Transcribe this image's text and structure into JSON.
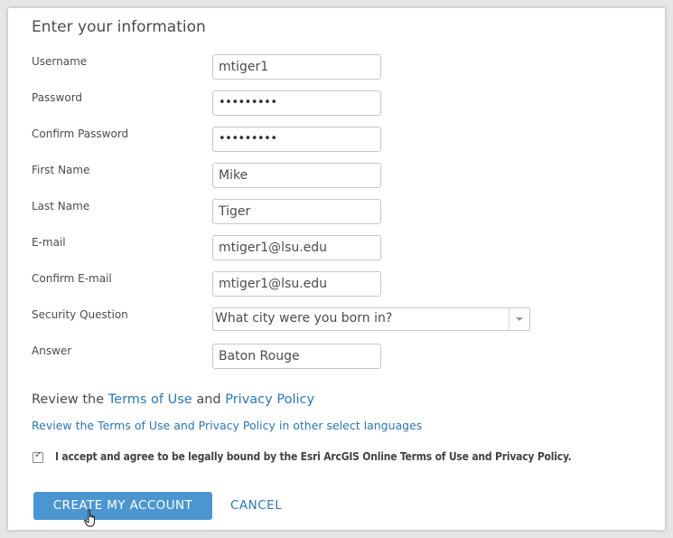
{
  "form": {
    "title": "Enter your information",
    "fields": [
      {
        "label": "Username",
        "value": "mtiger1",
        "type": "text"
      },
      {
        "label": "Password",
        "value": "•••••••••",
        "type": "password"
      },
      {
        "label": "Confirm Password",
        "value": "•••••••••",
        "type": "password"
      },
      {
        "label": "First Name",
        "value": "Mike",
        "type": "text"
      },
      {
        "label": "Last Name",
        "value": "Tiger",
        "type": "text"
      },
      {
        "label": "E-mail",
        "value": "mtiger1@lsu.edu",
        "type": "text"
      },
      {
        "label": "Confirm E-mail",
        "value": "mtiger1@lsu.edu",
        "type": "text"
      }
    ],
    "security_question": {
      "label": "Security Question",
      "selected": "What city were you born in?"
    },
    "answer": {
      "label": "Answer",
      "value": "Baton Rouge"
    }
  },
  "review": {
    "prefix": "Review the ",
    "terms_link": "Terms of Use",
    "and": " and ",
    "privacy_link": "Privacy Policy",
    "other_languages_link": "Review the Terms of Use and Privacy Policy in other select languages"
  },
  "accept": {
    "checked": true,
    "label": "I accept and agree to be legally bound by the Esri ArcGIS Online Terms of Use and Privacy Policy."
  },
  "buttons": {
    "create": "CREATE MY ACCOUNT",
    "cancel": "CANCEL"
  },
  "colors": {
    "primary": "#4b96d1",
    "link": "#2e77b2",
    "text": "#4c4c4c"
  }
}
